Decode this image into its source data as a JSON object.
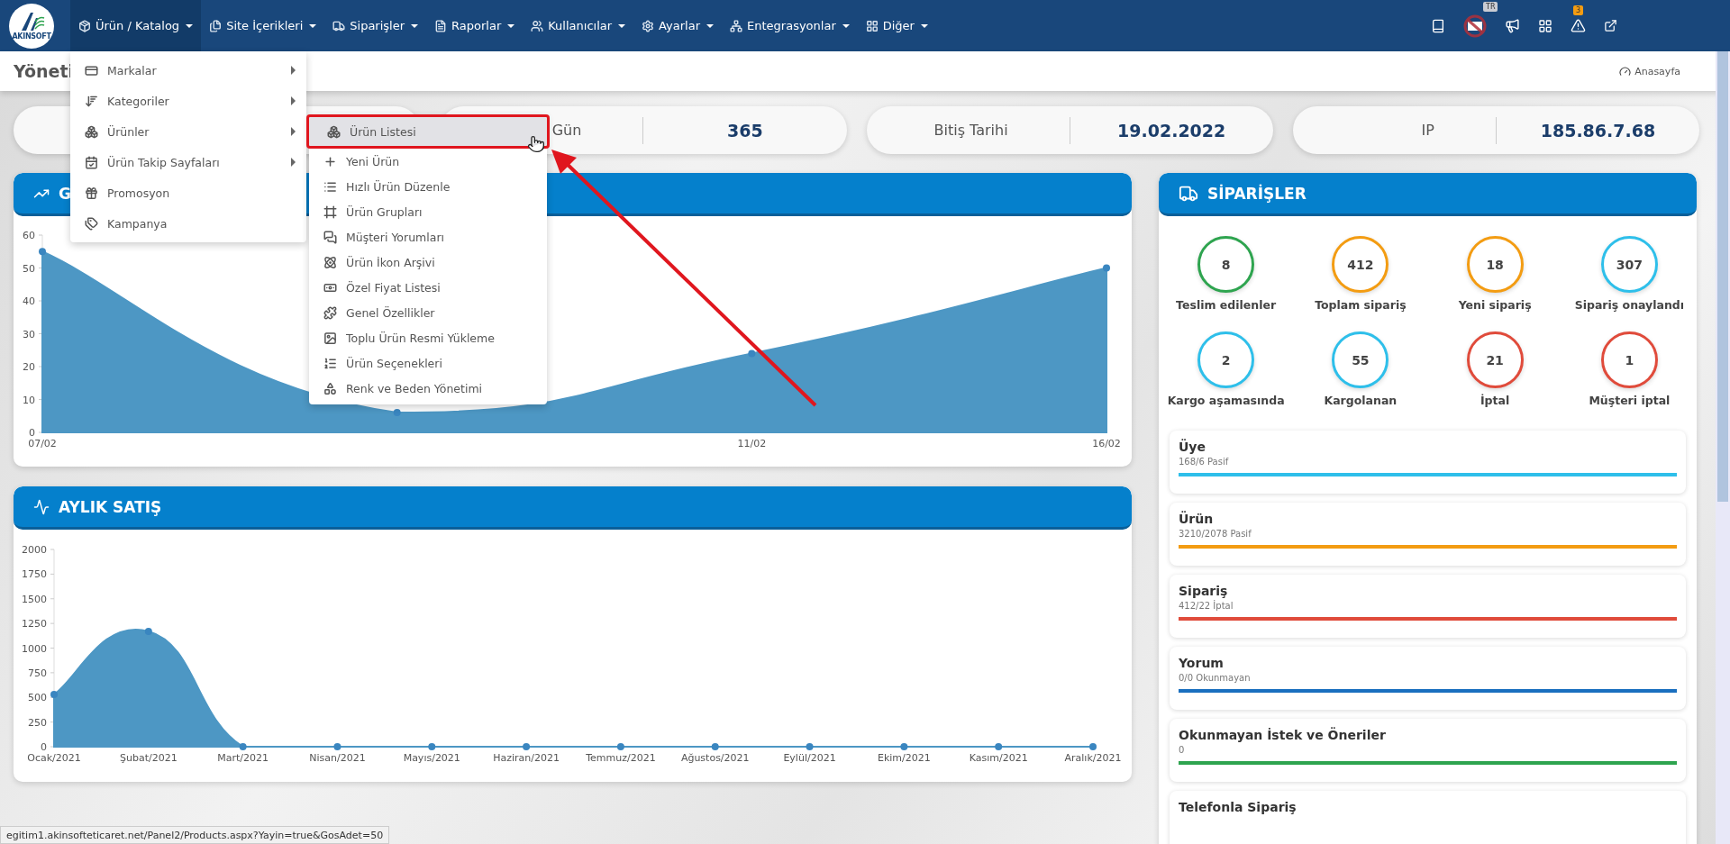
{
  "navbar": {
    "logo_text": "AKINSOFT",
    "items": [
      {
        "label": "Ürün / Katalog",
        "selected": true
      },
      {
        "label": "Site İçerikleri",
        "selected": false
      },
      {
        "label": "Siparişler",
        "selected": false
      },
      {
        "label": "Raporlar",
        "selected": false
      },
      {
        "label": "Kullanıcılar",
        "selected": false
      },
      {
        "label": "Ayarlar",
        "selected": false
      },
      {
        "label": "Entegrasyonlar",
        "selected": false
      },
      {
        "label": "Diğer",
        "selected": false
      }
    ],
    "language_badge": "TR",
    "alert_count": "3"
  },
  "breadcrumb": {
    "title": "Yöneti",
    "home": "Anasayfa"
  },
  "stat_cards": [
    {
      "label": "Gün",
      "value": "365"
    },
    {
      "label": "Bitiş Tarihi",
      "value": "19.02.2022"
    },
    {
      "label": "IP",
      "value": "185.86.7.68"
    }
  ],
  "daily_chart": {
    "title": "G",
    "chart_data": {
      "type": "area",
      "categories": [
        "07/02",
        null,
        "11/02",
        "16/02"
      ],
      "ylim": [
        0,
        60
      ],
      "yticks": [
        0,
        10,
        20,
        30,
        40,
        50,
        60
      ],
      "series": [
        {
          "color": "#4d97c4",
          "values": [
            55,
            6,
            24,
            50
          ]
        }
      ]
    }
  },
  "monthly_chart": {
    "title": "AYLIK SATIŞ",
    "chart_data": {
      "type": "area",
      "categories": [
        "Ocak/2021",
        "Şubat/2021",
        "Mart/2021",
        "Nisan/2021",
        "Mayıs/2021",
        "Haziran/2021",
        "Temmuz/2021",
        "Ağustos/2021",
        "Eylül/2021",
        "Ekim/2021",
        "Kasım/2021",
        "Aralık/2021"
      ],
      "ylim": [
        0,
        2000
      ],
      "yticks": [
        0,
        250,
        500,
        750,
        1000,
        1250,
        1500,
        1750,
        2000
      ],
      "series": [
        {
          "color": "#4d97c4",
          "values": [
            530,
            1170,
            0,
            0,
            0,
            0,
            0,
            0,
            0,
            0,
            0,
            0
          ]
        }
      ]
    }
  },
  "orders": {
    "title": "SİPARİŞLER",
    "counters": [
      {
        "value": "8",
        "label": "Teslim edilenler",
        "color": "#2ea44f"
      },
      {
        "value": "412",
        "label": "Toplam sipariş",
        "color": "#f39c12"
      },
      {
        "value": "18",
        "label": "Yeni sipariş",
        "color": "#f39c12"
      },
      {
        "value": "307",
        "label": "Sipariş onaylandı",
        "color": "#2ebfea"
      },
      {
        "value": "2",
        "label": "Kargo aşamasında",
        "color": "#2ebfea"
      },
      {
        "value": "55",
        "label": "Kargolanan",
        "color": "#2ebfea"
      },
      {
        "value": "21",
        "label": "İptal",
        "color": "#e04b3b"
      },
      {
        "value": "1",
        "label": "Müşteri iptal",
        "color": "#e04b3b"
      }
    ],
    "summaries": [
      {
        "title": "Üye",
        "subtitle": "168/6 Pasif",
        "color": "#2ebfea",
        "level": 1
      },
      {
        "title": "Ürün",
        "subtitle": "3210/2078 Pasif",
        "color": "#f39c12",
        "level": 1
      },
      {
        "title": "Sipariş",
        "subtitle": "412/22 İptal",
        "color": "#e04b3b",
        "level": 1
      },
      {
        "title": "Yorum",
        "subtitle": "0/0 Okunmayan",
        "color": "#1a6fbf",
        "level": 1
      },
      {
        "title": "Okunmayan İstek ve Öneriler",
        "subtitle": "0",
        "color": "#2ea44f",
        "level": 1
      },
      {
        "title": "Telefonla Sipariş"
      }
    ]
  },
  "menu": {
    "items": [
      {
        "label": "Markalar",
        "has_submenu": true
      },
      {
        "label": "Kategoriler",
        "has_submenu": true
      },
      {
        "label": "Ürünler",
        "has_submenu": true
      },
      {
        "label": "Ürün Takip Sayfaları",
        "has_submenu": true
      },
      {
        "label": "Promosyon",
        "has_submenu": false
      },
      {
        "label": "Kampanya",
        "has_submenu": false
      }
    ]
  },
  "submenu": {
    "items": [
      {
        "label": "Ürün Listesi",
        "selected": true
      },
      {
        "label": "Yeni Ürün",
        "selected": false
      },
      {
        "label": "Hızlı Ürün Düzenle",
        "selected": false
      },
      {
        "label": "Ürün Grupları",
        "selected": false
      },
      {
        "label": "Müşteri Yorumları",
        "selected": false
      },
      {
        "label": "Ürün İkon Arşivi",
        "selected": false
      },
      {
        "label": "Özel Fiyat Listesi",
        "selected": false
      },
      {
        "label": "Genel Özellikler",
        "selected": false
      },
      {
        "label": "Toplu Ürün Resmi Yükleme",
        "selected": false
      },
      {
        "label": "Ürün Seçenekleri",
        "selected": false
      },
      {
        "label": "Renk ve Beden Yönetimi",
        "selected": false
      }
    ]
  },
  "status_bar": {
    "url": "egitim1.akinsofteticaret.net/Panel2/Products.aspx?Yayin=true&GosAdet=50"
  }
}
